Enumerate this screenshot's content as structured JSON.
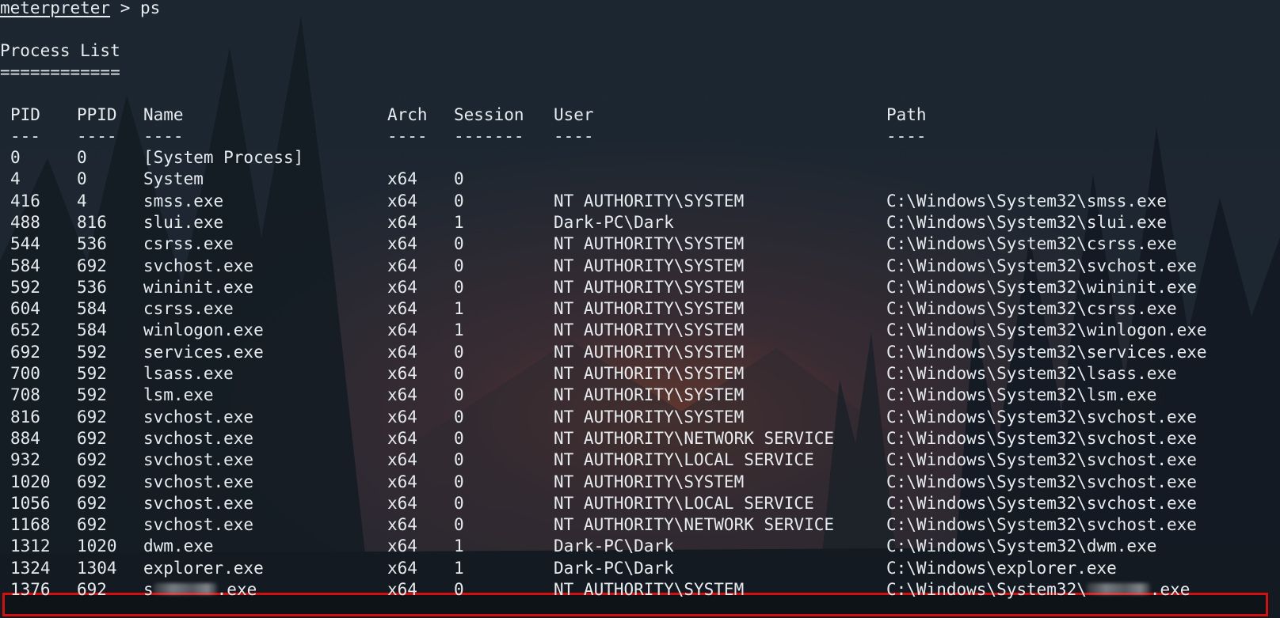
{
  "prompt": {
    "name": "meterpreter",
    "symbol": " > ",
    "command": "ps"
  },
  "heading": {
    "title": "Process List",
    "underline": "============"
  },
  "columns": {
    "pid": "PID",
    "ppid": "PPID",
    "name": "Name",
    "arch": "Arch",
    "session": "Session",
    "user": "User",
    "path": "Path"
  },
  "separators": {
    "pid": "---",
    "ppid": "----",
    "name": "----",
    "arch": "----",
    "session": "-------",
    "user": "----",
    "path": "----"
  },
  "processes": [
    {
      "pid": "0",
      "ppid": "0",
      "name": "[System Process]",
      "arch": "",
      "session": "",
      "user": "",
      "path": ""
    },
    {
      "pid": "4",
      "ppid": "0",
      "name": "System",
      "arch": "x64",
      "session": "0",
      "user": "",
      "path": ""
    },
    {
      "pid": "416",
      "ppid": "4",
      "name": "smss.exe",
      "arch": "x64",
      "session": "0",
      "user": "NT AUTHORITY\\SYSTEM",
      "path": "C:\\Windows\\System32\\smss.exe"
    },
    {
      "pid": "488",
      "ppid": "816",
      "name": "slui.exe",
      "arch": "x64",
      "session": "1",
      "user": "Dark-PC\\Dark",
      "path": "C:\\Windows\\System32\\slui.exe"
    },
    {
      "pid": "544",
      "ppid": "536",
      "name": "csrss.exe",
      "arch": "x64",
      "session": "0",
      "user": "NT AUTHORITY\\SYSTEM",
      "path": "C:\\Windows\\System32\\csrss.exe"
    },
    {
      "pid": "584",
      "ppid": "692",
      "name": "svchost.exe",
      "arch": "x64",
      "session": "0",
      "user": "NT AUTHORITY\\SYSTEM",
      "path": "C:\\Windows\\System32\\svchost.exe"
    },
    {
      "pid": "592",
      "ppid": "536",
      "name": "wininit.exe",
      "arch": "x64",
      "session": "0",
      "user": "NT AUTHORITY\\SYSTEM",
      "path": "C:\\Windows\\System32\\wininit.exe"
    },
    {
      "pid": "604",
      "ppid": "584",
      "name": "csrss.exe",
      "arch": "x64",
      "session": "1",
      "user": "NT AUTHORITY\\SYSTEM",
      "path": "C:\\Windows\\System32\\csrss.exe"
    },
    {
      "pid": "652",
      "ppid": "584",
      "name": "winlogon.exe",
      "arch": "x64",
      "session": "1",
      "user": "NT AUTHORITY\\SYSTEM",
      "path": "C:\\Windows\\System32\\winlogon.exe"
    },
    {
      "pid": "692",
      "ppid": "592",
      "name": "services.exe",
      "arch": "x64",
      "session": "0",
      "user": "NT AUTHORITY\\SYSTEM",
      "path": "C:\\Windows\\System32\\services.exe"
    },
    {
      "pid": "700",
      "ppid": "592",
      "name": "lsass.exe",
      "arch": "x64",
      "session": "0",
      "user": "NT AUTHORITY\\SYSTEM",
      "path": "C:\\Windows\\System32\\lsass.exe"
    },
    {
      "pid": "708",
      "ppid": "592",
      "name": "lsm.exe",
      "arch": "x64",
      "session": "0",
      "user": "NT AUTHORITY\\SYSTEM",
      "path": "C:\\Windows\\System32\\lsm.exe"
    },
    {
      "pid": "816",
      "ppid": "692",
      "name": "svchost.exe",
      "arch": "x64",
      "session": "0",
      "user": "NT AUTHORITY\\SYSTEM",
      "path": "C:\\Windows\\System32\\svchost.exe"
    },
    {
      "pid": "884",
      "ppid": "692",
      "name": "svchost.exe",
      "arch": "x64",
      "session": "0",
      "user": "NT AUTHORITY\\NETWORK SERVICE",
      "path": "C:\\Windows\\System32\\svchost.exe"
    },
    {
      "pid": "932",
      "ppid": "692",
      "name": "svchost.exe",
      "arch": "x64",
      "session": "0",
      "user": "NT AUTHORITY\\LOCAL SERVICE",
      "path": "C:\\Windows\\System32\\svchost.exe"
    },
    {
      "pid": "1020",
      "ppid": "692",
      "name": "svchost.exe",
      "arch": "x64",
      "session": "0",
      "user": "NT AUTHORITY\\SYSTEM",
      "path": "C:\\Windows\\System32\\svchost.exe"
    },
    {
      "pid": "1056",
      "ppid": "692",
      "name": "svchost.exe",
      "arch": "x64",
      "session": "0",
      "user": "NT AUTHORITY\\LOCAL SERVICE",
      "path": "C:\\Windows\\System32\\svchost.exe"
    },
    {
      "pid": "1168",
      "ppid": "692",
      "name": "svchost.exe",
      "arch": "x64",
      "session": "0",
      "user": "NT AUTHORITY\\NETWORK SERVICE",
      "path": "C:\\Windows\\System32\\svchost.exe"
    },
    {
      "pid": "1312",
      "ppid": "1020",
      "name": "dwm.exe",
      "arch": "x64",
      "session": "1",
      "user": "Dark-PC\\Dark",
      "path": "C:\\Windows\\System32\\dwm.exe"
    },
    {
      "pid": "1324",
      "ppid": "1304",
      "name": "explorer.exe",
      "arch": "x64",
      "session": "1",
      "user": "Dark-PC\\Dark",
      "path": "C:\\Windows\\explorer.exe"
    }
  ],
  "highlighted": {
    "pid": "1376",
    "ppid": "692",
    "name_prefix": "s",
    "name_suffix": ".exe",
    "arch": "x64",
    "session": "0",
    "user": "NT AUTHORITY\\SYSTEM",
    "path_prefix": "C:\\Windows\\System32\\",
    "path_suffix": ".exe"
  },
  "colors": {
    "highlight_border": "#d40f0f",
    "text": "#e6ebee",
    "background": "#1c2630"
  }
}
